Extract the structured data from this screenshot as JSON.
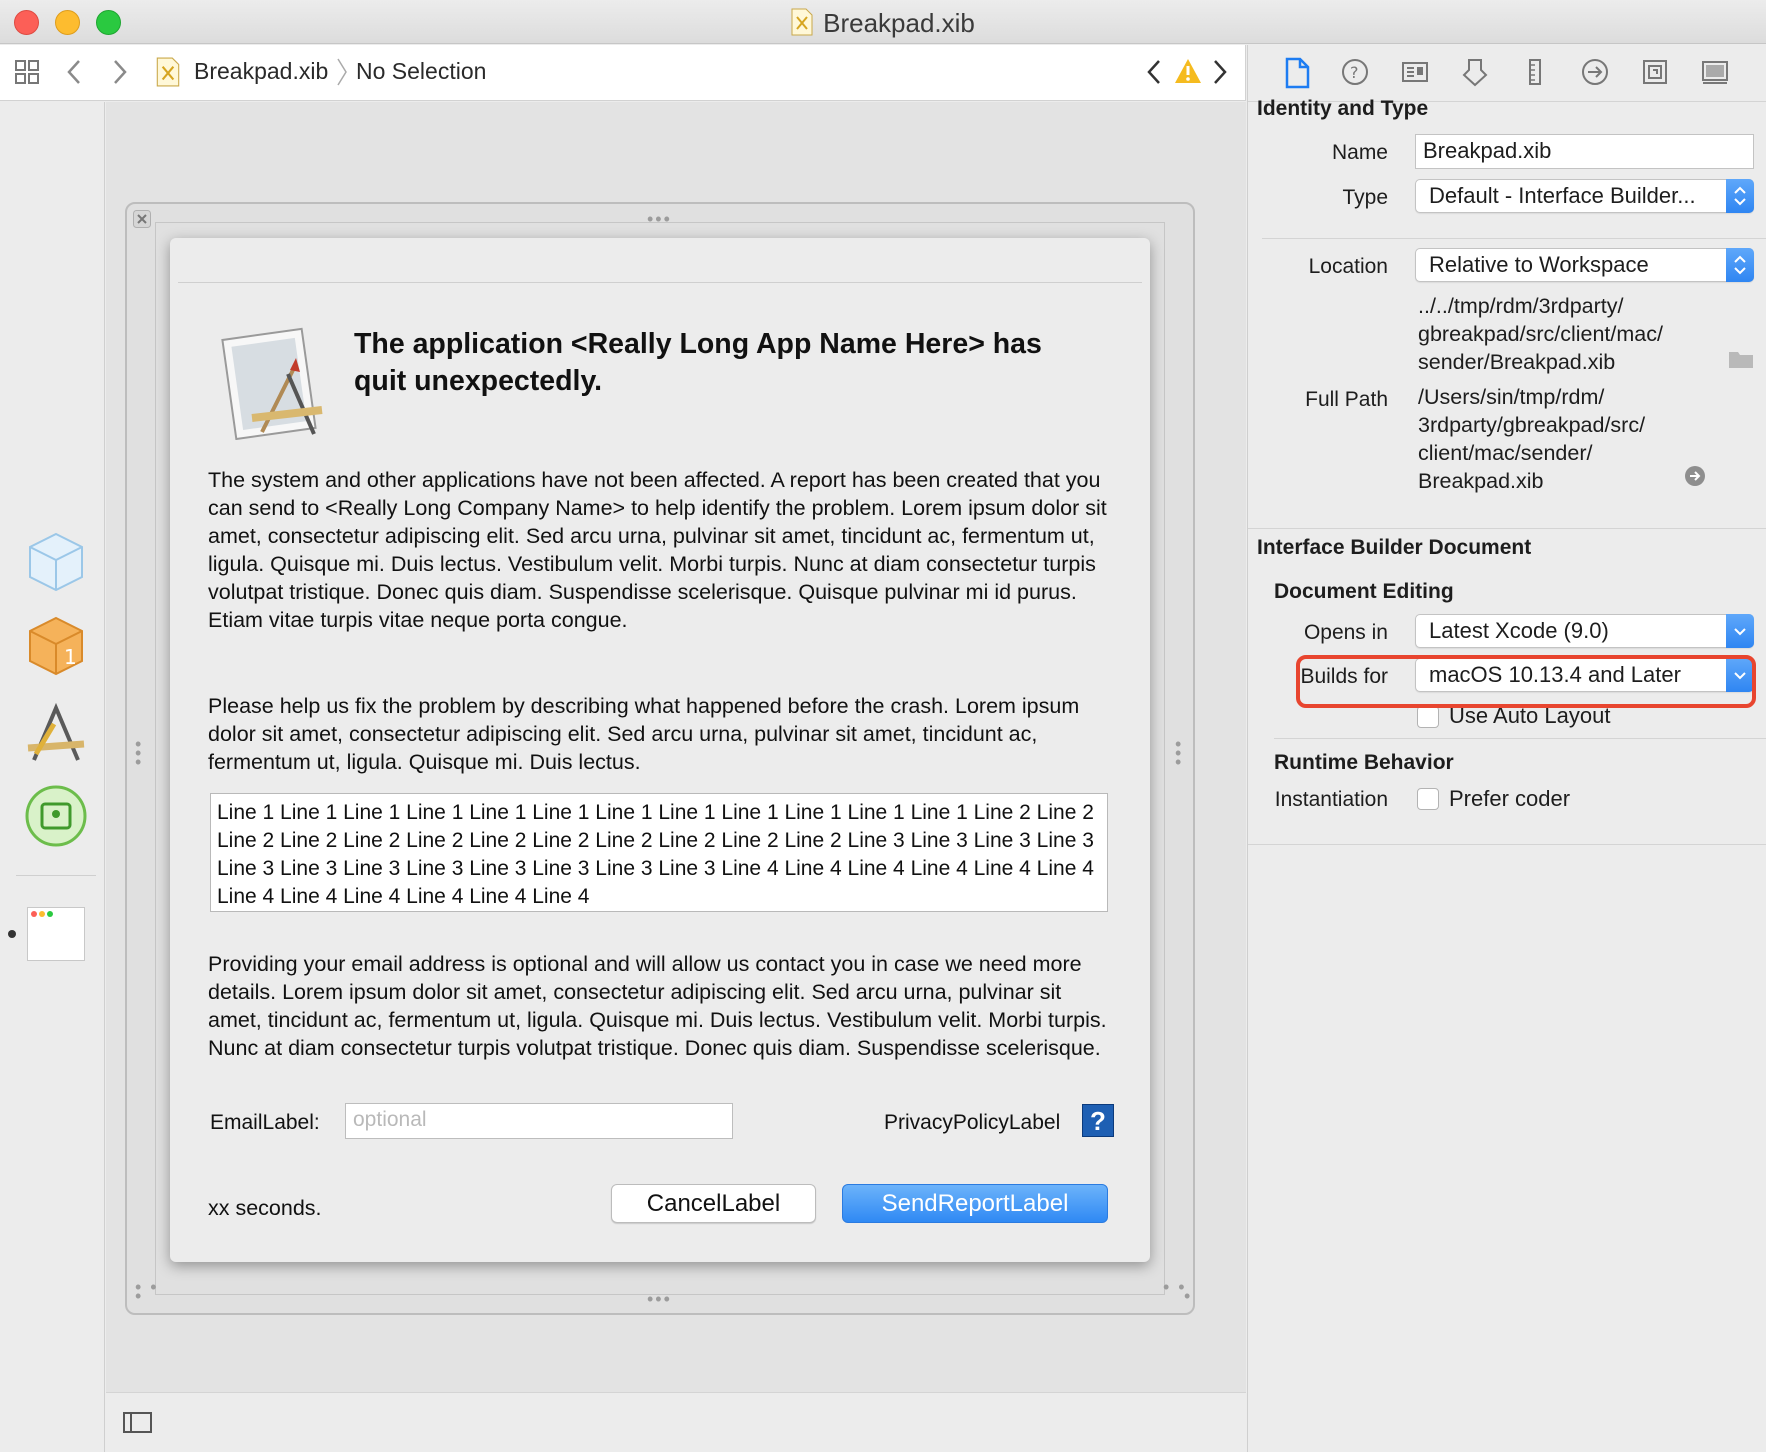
{
  "window": {
    "title": "Breakpad.xib"
  },
  "jumpbar": {
    "file": "Breakpad.xib",
    "selection": "No Selection"
  },
  "dialog": {
    "headline": "The application <Really Long App Name Here> has quit unexpectedly.",
    "paragraph1": "The system and other applications have not been affected. A report has been created that you can send to <Really Long Company Name> to help identify the problem. Lorem ipsum dolor sit amet, consectetur adipiscing elit. Sed arcu urna, pulvinar sit amet, tincidunt ac, fermentum ut, ligula. Quisque mi. Duis lectus. Vestibulum velit. Morbi turpis. Nunc at diam consectetur turpis volutpat tristique. Donec quis diam. Suspendisse scelerisque. Quisque pulvinar mi id purus. Etiam vitae turpis vitae neque porta congue.",
    "paragraph2": "Please help us fix the problem by describing what happened before the crash. Lorem ipsum dolor sit amet, consectetur adipiscing elit. Sed arcu urna, pulvinar sit amet, tincidunt ac, fermentum ut, ligula. Quisque mi. Duis lectus.",
    "log_text": "Line 1 Line 1 Line 1 Line 1 Line 1 Line 1 Line 1 Line 1 Line 1 Line 1 Line 1 Line 1 Line 2 Line 2 Line 2 Line 2 Line 2 Line 2 Line 2 Line 2 Line 2 Line 2 Line 2 Line 2 Line 3 Line 3 Line 3 Line 3 Line 3 Line 3 Line 3 Line 3 Line 3 Line 3 Line 3 Line 3 Line 4 Line 4 Line 4 Line 4 Line 4 Line 4 Line 4 Line 4 Line 4 Line 4 Line 4 Line 4",
    "paragraph3": "Providing your email address is optional and will allow us contact you in case we need more details. Lorem ipsum dolor sit amet, consectetur adipiscing elit. Sed arcu urna, pulvinar sit amet, tincidunt ac, fermentum ut, ligula. Quisque mi. Duis lectus. Vestibulum velit. Morbi turpis. Nunc at diam consectetur turpis volutpat tristique. Donec quis diam. Suspendisse scelerisque.",
    "email_label": "EmailLabel:",
    "email_placeholder": "optional",
    "privacy_label": "PrivacyPolicyLabel",
    "help_glyph": "?",
    "countdown": "xx seconds.",
    "cancel_label": "CancelLabel",
    "send_label": "SendReportLabel"
  },
  "inspector": {
    "identity_title": "Identity and Type",
    "name_label": "Name",
    "name_value": "Breakpad.xib",
    "type_label": "Type",
    "type_value": "Default - Interface Builder...",
    "location_label": "Location",
    "location_value": "Relative to Workspace",
    "relative_path": "../../tmp/rdm/3rdparty/ gbreakpad/src/client/mac/ sender/Breakpad.xib",
    "full_path_label": "Full Path",
    "full_path_value": "/Users/sin/tmp/rdm/ 3rdparty/gbreakpad/src/ client/mac/sender/ Breakpad.xib",
    "ib_doc_title": "Interface Builder Document",
    "doc_editing_title": "Document Editing",
    "opens_in_label": "Opens in",
    "opens_in_value": "Latest Xcode (9.0)",
    "builds_for_label": "Builds for",
    "builds_for_value": "macOS 10.13.4 and Later",
    "auto_layout_label": "Use Auto Layout",
    "runtime_title": "Runtime Behavior",
    "instantiation_label": "Instantiation",
    "prefer_coder_label": "Prefer coder"
  },
  "colors": {
    "accent": "#2f86f2",
    "highlight": "#e8452f"
  }
}
